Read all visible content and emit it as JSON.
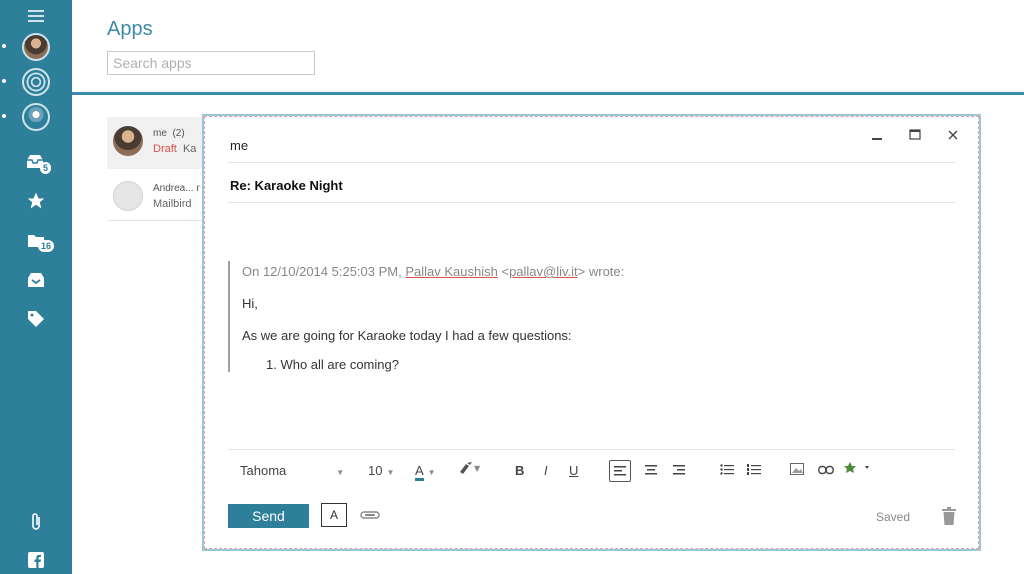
{
  "header": {
    "title": "Apps",
    "search_placeholder": "Search apps"
  },
  "sidebar": {
    "badges": {
      "inbox": "5",
      "folders": "16"
    },
    "icons": [
      "menu-icon",
      "account-avatar-1",
      "account-avatar-2",
      "account-avatar-3",
      "inbox-icon",
      "star-icon",
      "folders-icon",
      "archive-icon",
      "tag-icon",
      "attachment-icon",
      "facebook-icon"
    ]
  },
  "messages": [
    {
      "from": "me",
      "count": "(2)",
      "status": "Draft",
      "preview": "Ka"
    },
    {
      "from": "Andrea... r",
      "preview": "Mailbird"
    }
  ],
  "compose": {
    "to": "me",
    "subject": "Re: Karaoke Night",
    "quote_header_prefix": "On 12/10/2014 5:25:03 PM, ",
    "quote_sender": "Pallav Kaushish",
    "quote_email_open": " <",
    "quote_email": "pallav@liv.it",
    "quote_email_close": "> wrote:",
    "body_greeting": "Hi,",
    "body_text": "As we are going for Karaoke today I had a few questions:",
    "list_items": [
      "1.  Who all are coming?"
    ],
    "toolbar": {
      "font": "Tahoma",
      "size": "10",
      "text_color_label": "A",
      "bold": "B",
      "italic": "I",
      "underline": "U"
    },
    "send_label": "Send",
    "format_label": "A",
    "status": "Saved"
  },
  "colors": {
    "accent": "#2e7f9a",
    "draft": "#d9534f"
  }
}
